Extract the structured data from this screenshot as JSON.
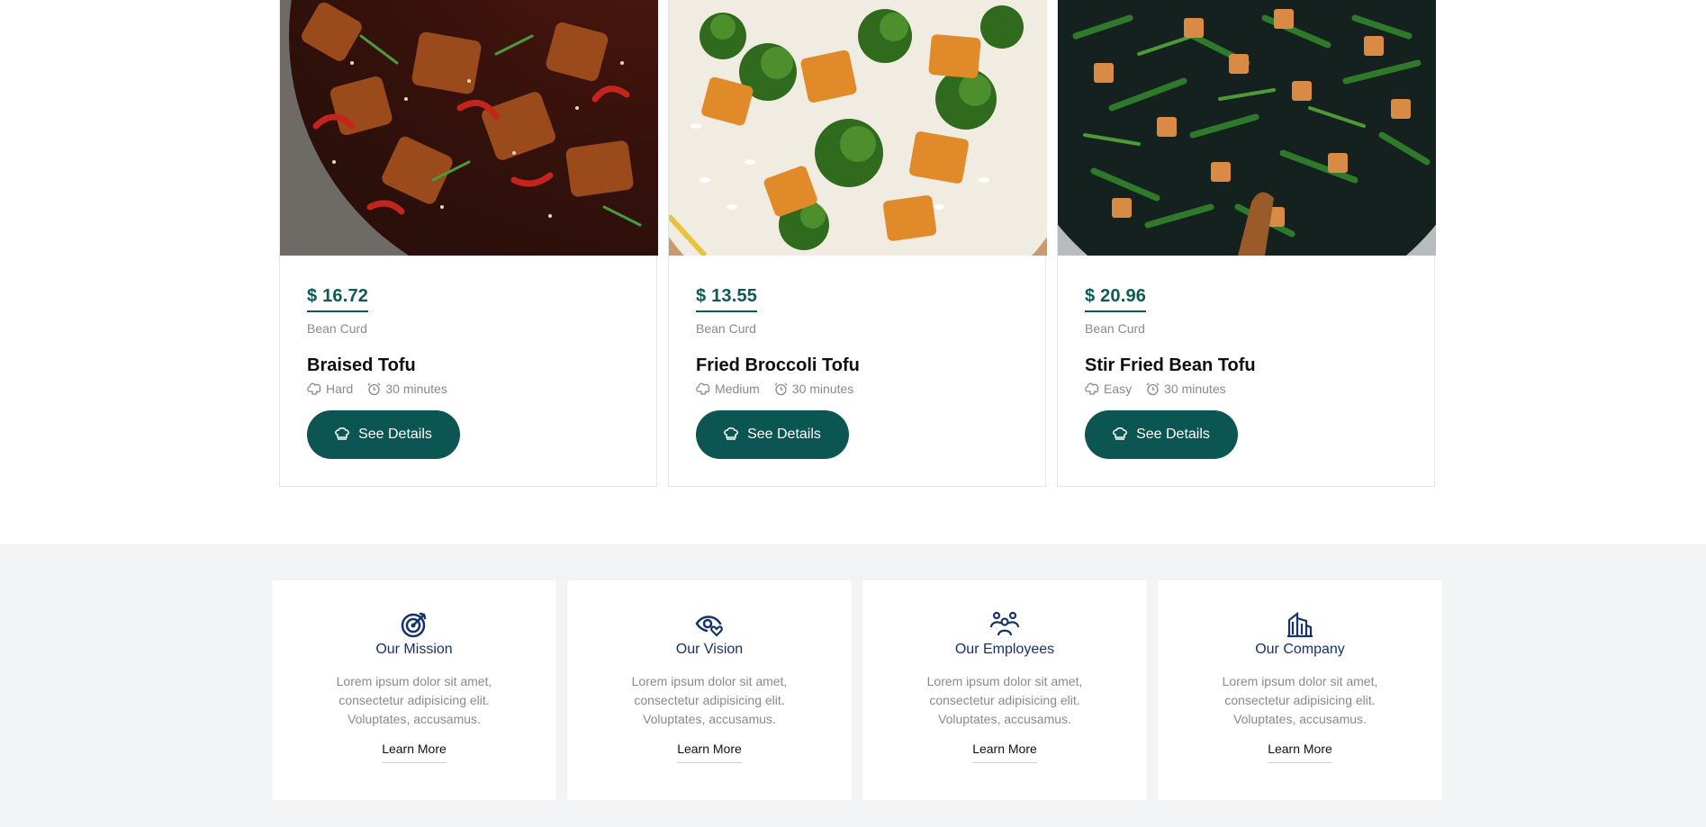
{
  "recipes": [
    {
      "price": "$ 16.72",
      "category": "Bean Curd",
      "title": "Braised Tofu",
      "difficulty": "Hard",
      "time": "30 minutes",
      "button": "See Details"
    },
    {
      "price": "$ 13.55",
      "category": "Bean Curd",
      "title": "Fried Broccoli Tofu",
      "difficulty": "Medium",
      "time": "30 minutes",
      "button": "See Details"
    },
    {
      "price": "$ 20.96",
      "category": "Bean Curd",
      "title": "Stir Fried Bean Tofu",
      "difficulty": "Easy",
      "time": "30 minutes",
      "button": "See Details"
    }
  ],
  "about": [
    {
      "icon": "target-icon",
      "title": "Our Mission",
      "text": "Lorem ipsum dolor sit amet, consectetur adipisicing elit. Voluptates, accusamus.",
      "link": "Learn More"
    },
    {
      "icon": "eye-heart-icon",
      "title": "Our Vision",
      "text": "Lorem ipsum dolor sit amet, consectetur adipisicing elit. Voluptates, accusamus.",
      "link": "Learn More"
    },
    {
      "icon": "people-icon",
      "title": "Our Employees",
      "text": "Lorem ipsum dolor sit amet, consectetur adipisicing elit. Voluptates, accusamus.",
      "link": "Learn More"
    },
    {
      "icon": "building-icon",
      "title": "Our Company",
      "text": "Lorem ipsum dolor sit amet, consectetur adipisicing elit. Voluptates, accusamus.",
      "link": "Learn More"
    }
  ],
  "colors": {
    "brand": "#0b5552",
    "price": "#0f5a57",
    "about_heading": "#14336b",
    "section_bg": "#f2f3f5"
  }
}
